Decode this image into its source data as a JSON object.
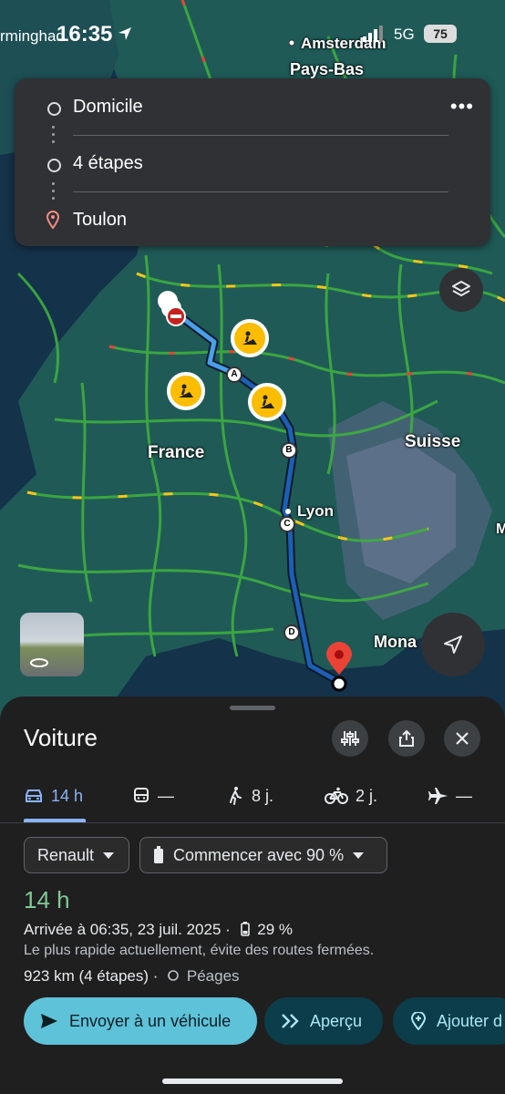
{
  "status": {
    "time": "16:35",
    "left_text": "rminghad",
    "network": "5G",
    "battery": "75"
  },
  "map": {
    "labels": {
      "amsterdam": "Amsterdam",
      "pays_bas": "Pays-Bas",
      "france": "France",
      "suisse": "Suisse",
      "lyon": "Lyon",
      "monaco": "Mona",
      "edge_m": "M"
    },
    "waypoints": [
      "A",
      "B",
      "C",
      "D"
    ]
  },
  "route_card": {
    "origin": "Domicile",
    "stops": "4 étapes",
    "destination": "Toulon",
    "more": "•••"
  },
  "sheet": {
    "title": "Voiture",
    "modes": [
      {
        "name": "car",
        "label": "14 h"
      },
      {
        "name": "transit",
        "label": "—"
      },
      {
        "name": "walk",
        "label": "8 j."
      },
      {
        "name": "bike",
        "label": "2 j."
      },
      {
        "name": "flight",
        "label": "—"
      }
    ],
    "chips": {
      "vehicle": "Renault",
      "battery": "Commencer avec 90 %"
    },
    "duration": "14 h",
    "arrival": "Arrivée à 06:35, 23 juil. 2025 ·",
    "arrival_battery": "29 %",
    "note": "Le plus rapide actuellement, évite des routes fermées.",
    "distance": "923 km (4 étapes) ·",
    "tolls": "Péages",
    "actions": {
      "send": "Envoyer à un véhicule",
      "preview": "Aperçu",
      "add": "Ajouter d"
    }
  },
  "colors": {
    "accent": "#8ab4f8",
    "duration_green": "#81c995",
    "primary_btn": "#5ec2d9",
    "secondary_btn": "#0b3d4a",
    "map_water": "#14324a",
    "map_land": "#1f5a57",
    "roads": "#3fae3f"
  }
}
